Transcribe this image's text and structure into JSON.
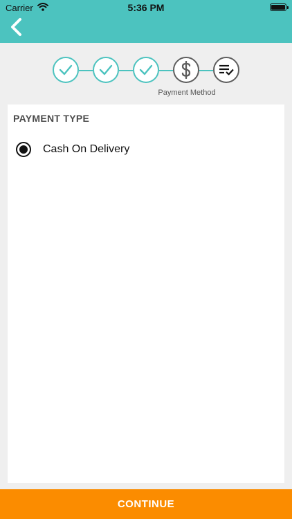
{
  "status_bar": {
    "carrier": "Carrier",
    "time": "5:36 PM"
  },
  "header": {
    "back_icon": "chevron-left-icon"
  },
  "stepper": {
    "accent_color": "#4cc3bf",
    "pending_color": "#5d5d5d",
    "steps": [
      {
        "icon": "check-icon",
        "state": "completed"
      },
      {
        "icon": "check-icon",
        "state": "completed"
      },
      {
        "icon": "check-icon",
        "state": "completed"
      },
      {
        "icon": "dollar-icon",
        "state": "current",
        "label": "Payment Method"
      },
      {
        "icon": "list-check-icon",
        "state": "upcoming"
      }
    ]
  },
  "payment": {
    "section_title": "PAYMENT TYPE",
    "options": [
      {
        "label": "Cash On Delivery",
        "selected": true
      }
    ]
  },
  "footer": {
    "continue_label": "CONTINUE",
    "button_color": "#fb8c00"
  }
}
